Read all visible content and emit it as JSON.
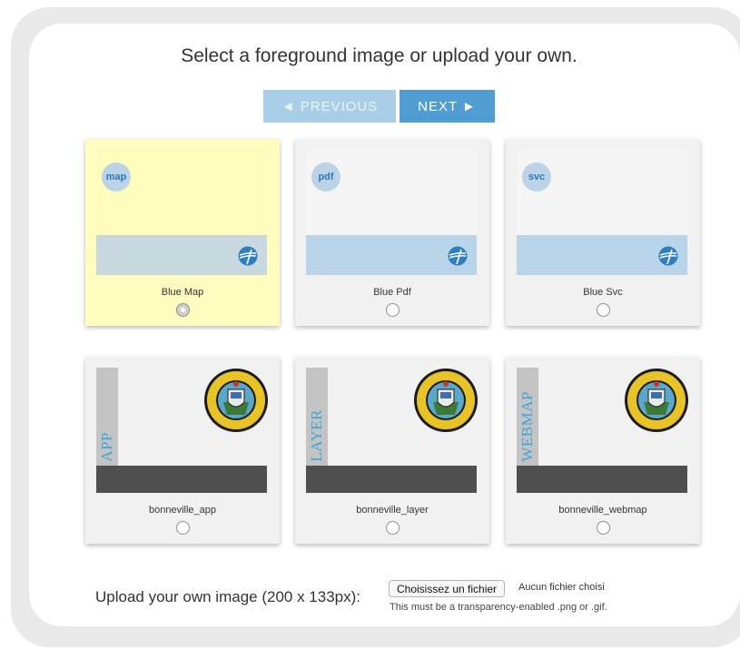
{
  "header": {
    "title": "Select a foreground image or upload your own."
  },
  "nav": {
    "previous_label": "◄ PREVIOUS",
    "next_label": "NEXT ►"
  },
  "cards": [
    {
      "label": "Blue Map",
      "badge": "map",
      "selected": true
    },
    {
      "label": "Blue Pdf",
      "badge": "pdf",
      "selected": false
    },
    {
      "label": "Blue Svc",
      "badge": "svc",
      "selected": false
    },
    {
      "label": "bonneville_app",
      "vertical_text": "APP",
      "selected": false
    },
    {
      "label": "bonneville_layer",
      "vertical_text": "LAYER",
      "selected": false
    },
    {
      "label": "bonneville_webmap",
      "vertical_text": "WEBMAP",
      "selected": false
    }
  ],
  "upload": {
    "label": "Upload your own image (200 x 133px):",
    "button_label": "Choisissez un fichier",
    "status": "Aucun fichier choisi",
    "hint": "This must be a transparency-enabled .png or .gif."
  },
  "colors": {
    "next_button": "#4f9dd3",
    "previous_button": "#a9cfe8",
    "selected_card": "#fefcbf",
    "vertical_text": "#3ba5d8"
  },
  "icons": {
    "badge_logo": "globe-logo-icon",
    "seal": "county-seal-icon"
  }
}
